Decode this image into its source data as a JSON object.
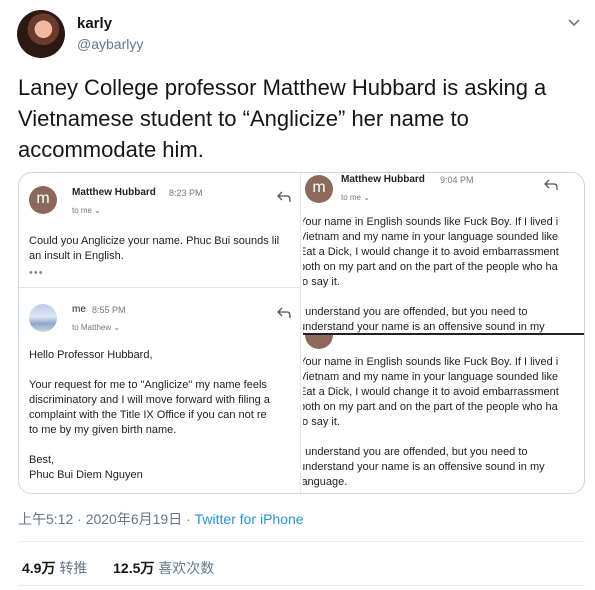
{
  "author": {
    "name": "karly",
    "handle": "@aybarlyy"
  },
  "tweet": {
    "text_lines": [
      "Laney College professor Matthew Hubbard is asking a",
      "Vietnamese student to “Anglicize” her name to",
      "accommodate him."
    ]
  },
  "media": {
    "left": {
      "email1": {
        "avatar_letter": "m",
        "sender": "Matthew Hubbard",
        "time": "8:23 PM",
        "to": "to me ⌄",
        "body": [
          "Could you Anglicize your name. Phuc Bui sounds lil",
          "an insult in English."
        ],
        "more": "•••"
      },
      "email2": {
        "sender": "me",
        "time": "8:55 PM",
        "to": "to Matthew ⌄",
        "body": [
          "Hello Professor Hubbard,",
          "",
          "Your request for me to \"Anglicize\" my name feels",
          "discriminatory and I will move forward with filing a",
          "complaint with the Title IX Office if you can not re",
          "to me by my given birth name.",
          "",
          "Best,",
          "Phuc Bui Diem Nguyen"
        ]
      }
    },
    "right": {
      "sender": "Matthew Hubbard",
      "time": "9:04 PM",
      "avatar_letter": "m",
      "to": "to me ⌄",
      "body_top": [
        "Your name in English sounds like Fuck Boy. If I lived i",
        "Vietnam and my name in your language sounded like",
        "Eat a Dick, I would change it to avoid embarrassment",
        "both on my part and on the part of the people who ha",
        "to say it.",
        "",
        "I understand you are offended, but you need to",
        "understand your name is an offensive sound in my"
      ],
      "body_bottom": [
        "Your name in English sounds like Fuck Boy. If I lived i",
        "Vietnam and my name in your language sounded like",
        "Eat a Dick, I would change it to avoid embarrassment",
        "both on my part and on the part of the people who ha",
        "to say it.",
        "",
        "I understand you are offended, but you need to",
        "understand your name is an offensive sound in my",
        "language."
      ]
    }
  },
  "meta": {
    "time_date": "上午5:12 · 2020年6月19日 · ",
    "source": "Twitter for iPhone"
  },
  "stats": {
    "retweets_count": "4.9万",
    "retweets_label": "转推",
    "likes_count": "12.5万",
    "likes_label": "喜欢次数"
  },
  "icons": {
    "caret": "chevron-down-icon",
    "reply": "reply-arrow-icon"
  }
}
